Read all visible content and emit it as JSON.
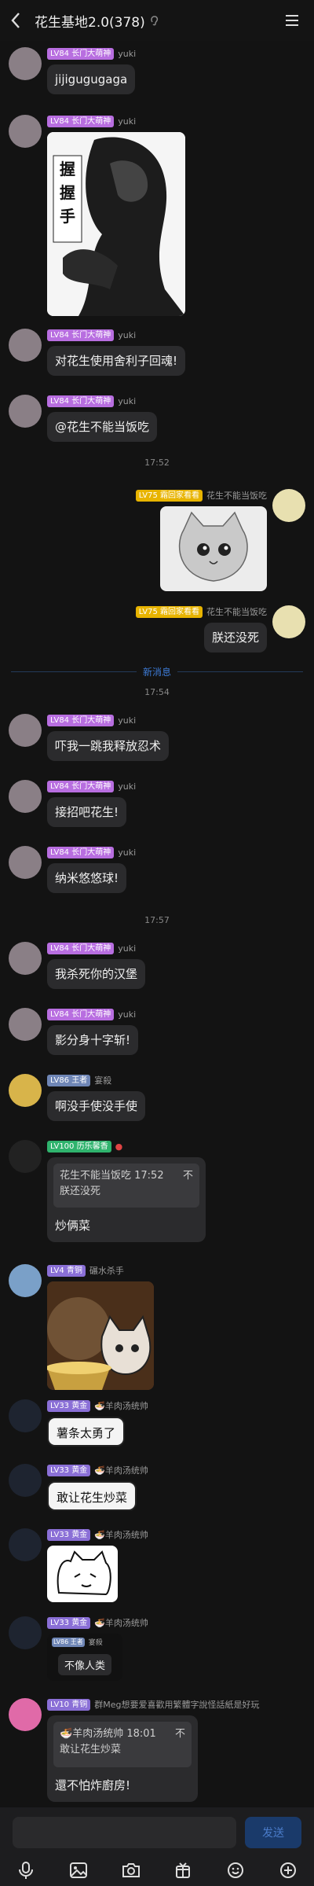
{
  "header": {
    "title": "花生基地2.0(378)",
    "mute_icon": "ear-icon",
    "menu_icon": "menu-icon"
  },
  "badges": {
    "changmen": "LV84 长门大萌神",
    "huahua": "LV75 霜回家看看",
    "wang": "LV86 王者",
    "li": "LV100 历乐馨香",
    "qing": "LV4 青铜",
    "huang": "LV33 黄金",
    "qing10": "LV10 青铜"
  },
  "senders": {
    "yuki": "yuki",
    "huasheng": "花生不能当饭吃",
    "yeshuo": "宴殺",
    "yangrou": "羊肉汤统帅",
    "zuanshi": "碾水杀手",
    "meg": "群Meg想要爱喜歡用繁體字說怪話紙是好玩"
  },
  "messages": {
    "m1": "jijigugugaga",
    "m2_caption": "握握手",
    "m3": "对花生使用舍利子回魂!",
    "m4": "@花生不能当饭吃",
    "t1": "17:52",
    "m6": "朕还没死",
    "new_label": "新消息",
    "t2": "17:54",
    "m7": "吓我一跳我释放忍术",
    "m8": "接招吧花生!",
    "m9": "纳米悠悠球!",
    "t3": "17:57",
    "m10": "我杀死你的汉堡",
    "m11": "影分身十字斩!",
    "m12": "啊没手使没手使",
    "q1_head": "花生不能当饭吃 17:52",
    "q1_x": "不",
    "q1_body": "朕还没死",
    "m13": "炒俩菜",
    "m15": "薯条太勇了",
    "m16": "敢让花生炒菜",
    "q2_badge": "LV86 王者",
    "q2_name": "宴殺",
    "q2_body": "不像人类",
    "q3_head": "羊肉汤统帅 18:01",
    "q3_x": "不",
    "q3_body": "敢让花生炒菜",
    "m19": "還不怕炸廚房!"
  },
  "input": {
    "placeholder": "",
    "send_label": "发送"
  },
  "toolbar": [
    "mic-icon",
    "image-icon",
    "camera-icon",
    "gift-icon",
    "emoji-icon",
    "plus-icon"
  ]
}
